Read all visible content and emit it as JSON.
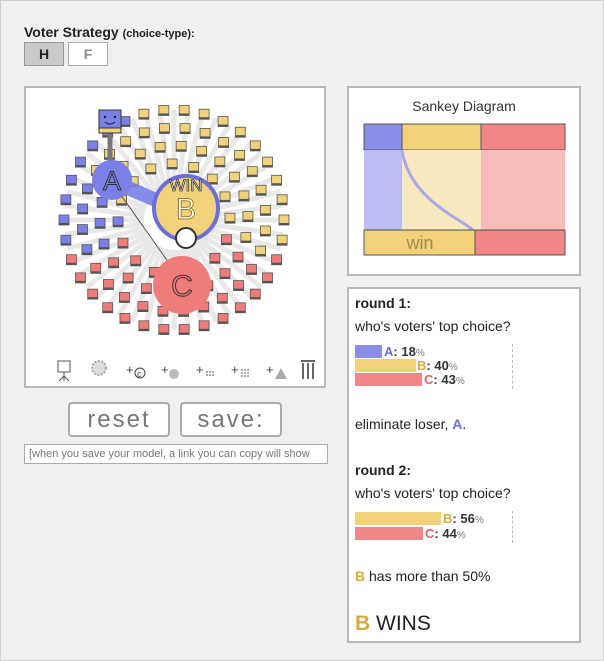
{
  "strategy": {
    "title": "Voter Strategy",
    "subtitle": "(choice-type):",
    "options": [
      "H",
      "F"
    ],
    "selected": "H"
  },
  "simulation": {
    "win_label": "WIN",
    "candidates": [
      {
        "id": "A",
        "color": "#7b7fe8"
      },
      {
        "id": "B",
        "color": "#f1d27a"
      },
      {
        "id": "C",
        "color": "#f07c7a"
      }
    ],
    "toolbar_icons": [
      "voter-tool-icon",
      "gear-icon",
      "add-candidate-icon",
      "add-voter-icon",
      "add-voter-crowd-icon",
      "add-voter-grid-icon",
      "add-voter-triangle-icon",
      "columns-icon"
    ]
  },
  "buttons": {
    "reset": "reset",
    "save": "save:"
  },
  "save_link_placeholder": "[when you save your model, a link you can copy will show",
  "sankey": {
    "title": "Sankey Diagram",
    "win_label": "win"
  },
  "results": {
    "round1": {
      "heading": "round 1:",
      "question": "who's voters' top choice?",
      "bars": [
        {
          "cand": "A",
          "value": 18,
          "pct": "%",
          "color": "#8b8ee8"
        },
        {
          "cand": "B",
          "value": 40,
          "pct": "%",
          "color": "#f1d27a"
        },
        {
          "cand": "C",
          "value": 43,
          "pct": "%",
          "color": "#f28585"
        }
      ],
      "eliminate_prefix": "eliminate loser,",
      "eliminated": "A",
      "eliminate_suffix": "."
    },
    "round2": {
      "heading": "round 2:",
      "question": "who's voters' top choice?",
      "bars": [
        {
          "cand": "B",
          "value": 56,
          "pct": "%",
          "color": "#f1d27a"
        },
        {
          "cand": "C",
          "value": 44,
          "pct": "%",
          "color": "#f28585"
        }
      ],
      "majority_cand": "B",
      "majority_text": "has more than 50%"
    },
    "winner": "B",
    "winner_text": "WINS"
  },
  "colors": {
    "A": "#7b7fe8",
    "B": "#f1d27a",
    "C": "#f07c7a"
  }
}
